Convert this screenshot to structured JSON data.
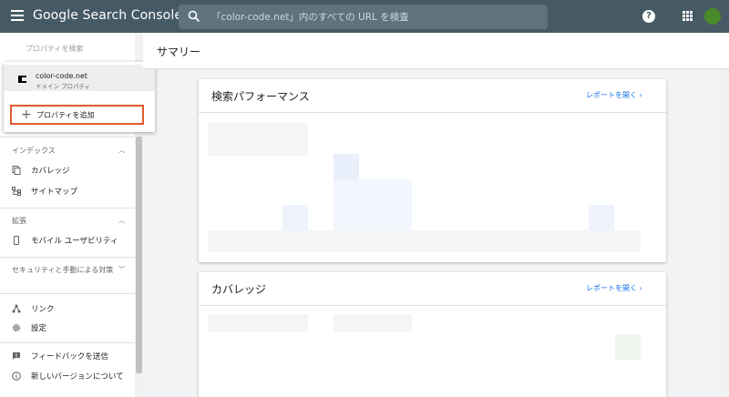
{
  "app": {
    "title": "Google Search Console"
  },
  "search": {
    "placeholder": "「color-code.net」内のすべての URL を検査"
  },
  "sidebar": {
    "property_search_label": "プロパティを検索",
    "sections": [
      {
        "label": "インデックス",
        "items": [
          {
            "label": "カバレッジ",
            "icon": "file-copy-icon"
          },
          {
            "label": "サイトマップ",
            "icon": "sitemap-icon"
          }
        ]
      },
      {
        "label": "拡張",
        "items": [
          {
            "label": "モバイル ユーザビリティ",
            "icon": "mobile-icon"
          }
        ]
      },
      {
        "label": "セキュリティと手動による対策",
        "items": []
      }
    ],
    "bottom_items": [
      {
        "label": "リンク",
        "icon": "links-icon"
      },
      {
        "label": "設定",
        "icon": "settings-icon"
      },
      {
        "label": "フィードバックを送信",
        "icon": "feedback-icon"
      },
      {
        "label": "新しいバージョンについて",
        "icon": "info-icon"
      }
    ]
  },
  "dropdown": {
    "property": {
      "name": "color-code.net",
      "type": "ドメイン プロパティ"
    },
    "add_label": "プロパティを追加"
  },
  "main": {
    "title": "サマリー",
    "cards": [
      {
        "title": "検索パフォーマンス",
        "link": "レポートを開く"
      },
      {
        "title": "カバレッジ",
        "link": "レポートを開く"
      }
    ]
  },
  "colors": {
    "topbar": "#455a64",
    "link": "#1a73e8",
    "highlight": "#e15b31"
  }
}
